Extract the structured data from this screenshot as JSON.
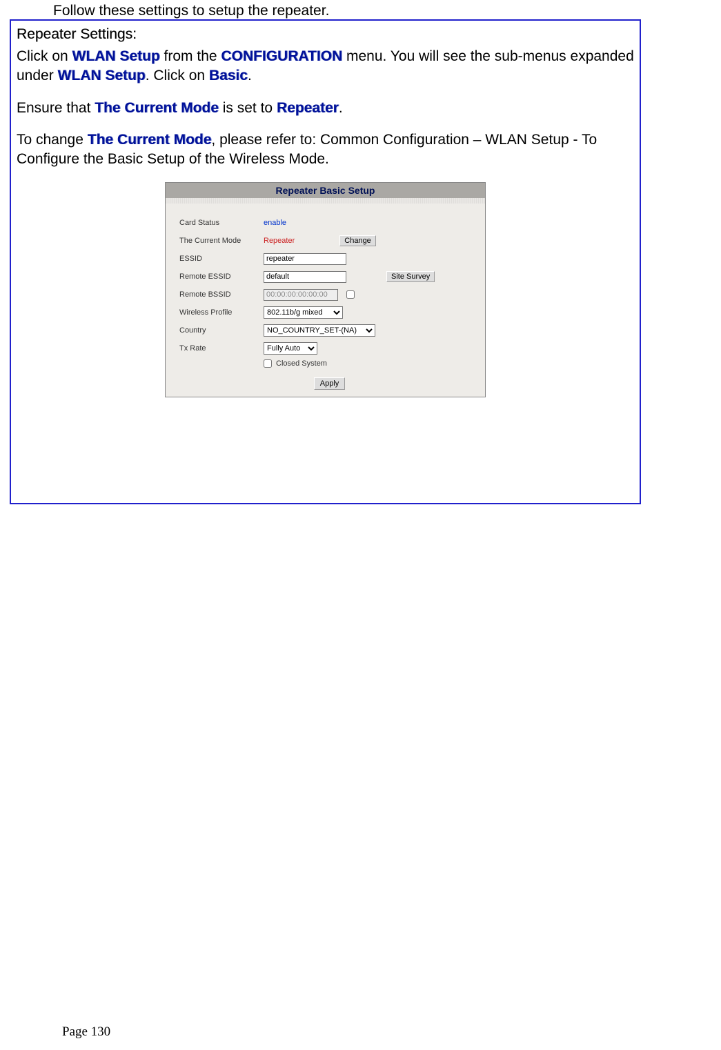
{
  "top_instruction": "Follow these settings to setup the repeater.",
  "box": {
    "heading": "Repeater Settings:",
    "para1": {
      "t1": "Click on ",
      "wlan_setup": "WLAN Setup",
      "t2": " from the ",
      "configuration": "CONFIGURATION",
      "t3": " menu. You will see the sub-menus expanded under ",
      "wlan_setup2": "WLAN Setup",
      "t4": ". Click on ",
      "basic": "Basic",
      "t5": "."
    },
    "para2": {
      "t1": "Ensure that ",
      "current_mode": "The Current Mode",
      "t2": " is set to ",
      "repeater": "Repeater",
      "t3": "."
    },
    "para3": {
      "t1": "To change ",
      "current_mode": "The Current Mode",
      "t2": ", please refer to: Common Configuration – WLAN Setup - To Configure the Basic Setup of the Wireless Mode."
    }
  },
  "panel": {
    "title": "Repeater Basic Setup",
    "labels": {
      "card_status": "Card Status",
      "current_mode": "The Current Mode",
      "essid": "ESSID",
      "remote_essid": "Remote ESSID",
      "remote_bssid": "Remote BSSID",
      "wireless_profile": "Wireless Profile",
      "country": "Country",
      "tx_rate": "Tx Rate",
      "closed_system": "Closed System"
    },
    "values": {
      "card_status": "enable",
      "current_mode": "Repeater",
      "essid": "repeater",
      "remote_essid": "default",
      "remote_bssid": "00:00:00:00:00:00",
      "wireless_profile": "802.11b/g mixed",
      "country": "NO_COUNTRY_SET-(NA)",
      "tx_rate": "Fully Auto"
    },
    "buttons": {
      "change": "Change",
      "site_survey": "Site Survey",
      "apply": "Apply"
    }
  },
  "footer": "Page 130"
}
